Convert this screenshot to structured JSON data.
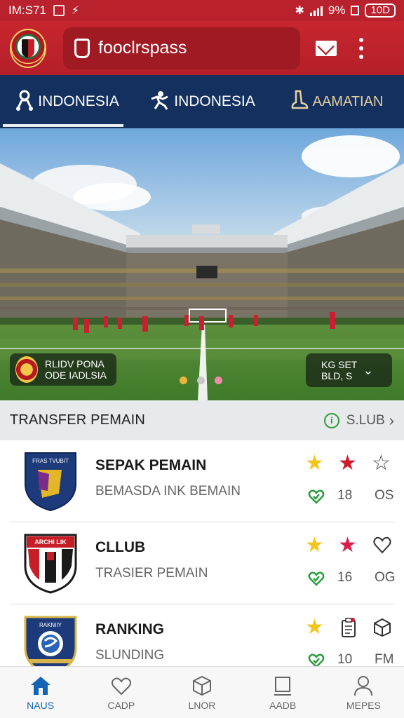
{
  "status_bar": {
    "time": "IM:S71",
    "battery": "9%",
    "battery_level": "10D"
  },
  "app_bar": {
    "search_text": "fooclrspass"
  },
  "tabs": [
    {
      "label": "INDONESIA",
      "icon": "person-icon",
      "active": true
    },
    {
      "label": "INDONESIA",
      "icon": "runner-icon",
      "active": false
    },
    {
      "label": "AAMATIAN",
      "icon": "boot-icon",
      "active": false
    }
  ],
  "hero": {
    "badge_text_line1": "RLIDV PONA",
    "badge_text_line2": "ODE IADLSIA",
    "right_line1": "KG SET",
    "right_line2": "BLD, S",
    "dot_colors": [
      "#e8b83a",
      "#c8c8c8",
      "#f08ca8"
    ]
  },
  "section": {
    "title": "TRANSFER PEMAIN",
    "link_label": "S.LUB"
  },
  "rows": [
    {
      "title": "SEPAK PEMAIN",
      "subtitle": "BEMASDA INK BEMAIN",
      "count": "18",
      "extra": "OS"
    },
    {
      "title": "CLLUB",
      "subtitle": "TRASIER PEMAIN",
      "count": "16",
      "extra": "OG"
    },
    {
      "title": "RANKING",
      "subtitle": "SLUNDING",
      "count": "10",
      "extra": "FM"
    }
  ],
  "crest_text": [
    "FRAS TVUBIT",
    "ARCHI LIK",
    "RAKNIIY"
  ],
  "bottom_nav": [
    {
      "label": "NAUS",
      "icon": "home-icon",
      "active": true
    },
    {
      "label": "CADP",
      "icon": "heart-icon",
      "active": false
    },
    {
      "label": "LNOR",
      "icon": "cube-icon",
      "active": false
    },
    {
      "label": "AADB",
      "icon": "frame-icon",
      "active": false
    },
    {
      "label": "MEPES",
      "icon": "profile-icon",
      "active": false
    }
  ],
  "colors": {
    "app_bar_red": "#c8262e",
    "tab_navy": "#14305e",
    "accent_blue": "#1565b7",
    "star_yellow": "#f3c51b",
    "star_red": "#cf1b2e",
    "heart_green": "#2a9d3a"
  }
}
